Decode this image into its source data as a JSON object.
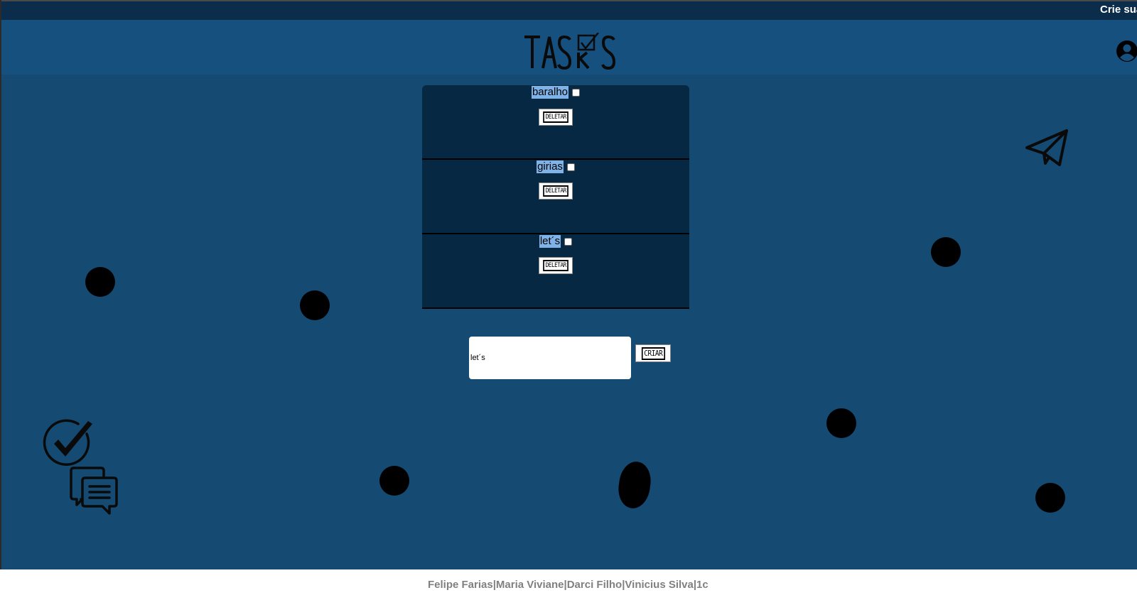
{
  "topbar": {
    "marquee_text": "Crie sua"
  },
  "header": {
    "logo_text": "TASKS",
    "profile_icon": "user-circle-icon"
  },
  "tasks": [
    {
      "name": "baralho",
      "checked": false,
      "delete_label": "DELETAR"
    },
    {
      "name": "girias",
      "checked": false,
      "delete_label": "DELETAR"
    },
    {
      "name": "let´s",
      "checked": false,
      "delete_label": "DELETAR"
    }
  ],
  "new_task": {
    "value": "let´s",
    "create_label": "CRIAR"
  },
  "decorations": {
    "send_icon": "paper-plane-icon",
    "check_icon": "check-circle-icon",
    "chat_icon": "chat-bubbles-icon"
  },
  "footer": {
    "credits": "Felipe Farias|Maria Viviane|Darci Filho|Vinicius Silva|1c"
  },
  "colors": {
    "topbar_bg": "#0c2c4b",
    "header_bg": "#16507f",
    "main_bg": "#154a72",
    "task_panel_bg": "#072843",
    "task_highlight": "#7fb3e8",
    "footer_text": "#808080"
  }
}
